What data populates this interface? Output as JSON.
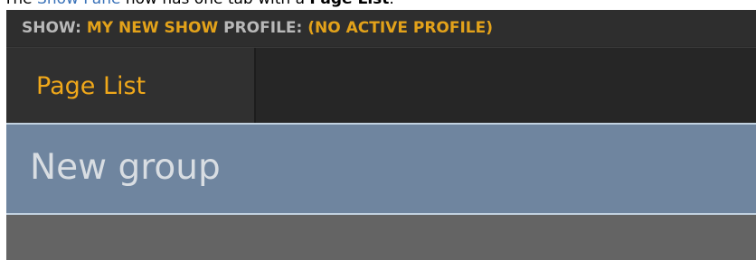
{
  "doc": {
    "prefix": "The ",
    "link": "Show Pane",
    "middle": " now has one tab with a ",
    "bold": "Page List",
    "suffix": "."
  },
  "show_bar": {
    "show_label": "SHOW: ",
    "show_name": "MY NEW SHOW",
    "profile_label": " PROFILE: ",
    "profile_value": "(NO ACTIVE PROFILE)"
  },
  "tabs": [
    {
      "label": "Page List"
    }
  ],
  "page_list": {
    "group_name": "New group"
  },
  "colors": {
    "accent": "#e3a21a",
    "tab_text": "#f0a81a",
    "group_bg": "#6f859f",
    "panel_bg": "#2b2b2b",
    "link": "#3b73b9"
  }
}
